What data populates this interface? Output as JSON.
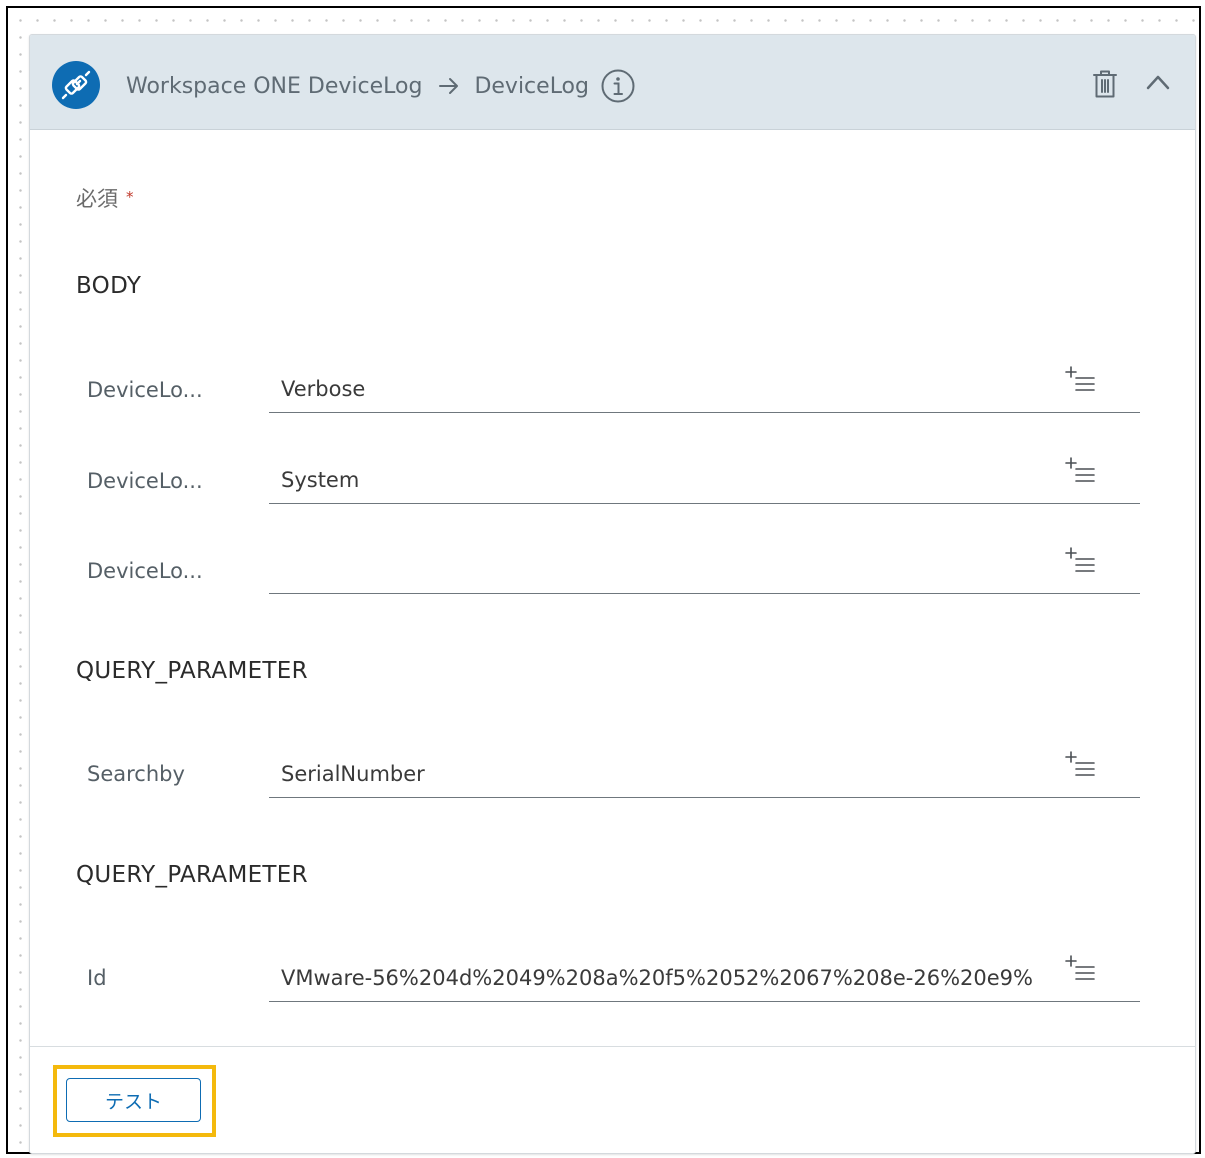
{
  "header": {
    "connector_name": "Workspace ONE DeviceLog",
    "action_name": "DeviceLog",
    "icons": {
      "connector": "plug-icon",
      "arrow": "arrow-right-icon",
      "info": "info-icon",
      "delete": "trash-icon",
      "collapse": "chevron-up-icon"
    }
  },
  "form": {
    "required_label": "必須",
    "required_mark": "*",
    "sections": [
      {
        "title": "BODY",
        "fields": [
          {
            "label": "DeviceLo...",
            "value": "Verbose"
          },
          {
            "label": "DeviceLo...",
            "value": "System"
          },
          {
            "label": "DeviceLo...",
            "value": ""
          }
        ]
      },
      {
        "title": "QUERY_PARAMETER",
        "fields": [
          {
            "label": "Searchby",
            "value": "SerialNumber"
          }
        ]
      },
      {
        "title": "QUERY_PARAMETER",
        "fields": [
          {
            "label": "Id",
            "value": "VMware-56%204d%2049%208a%20f5%2052%2067%208e-26%20e9%"
          }
        ]
      }
    ],
    "field_action_icon": "add-list-icon"
  },
  "footer": {
    "test_button_label": "テスト"
  },
  "colors": {
    "header_bg": "#dde6ec",
    "accent": "#0e6cb3",
    "highlight": "#f4b90d"
  }
}
